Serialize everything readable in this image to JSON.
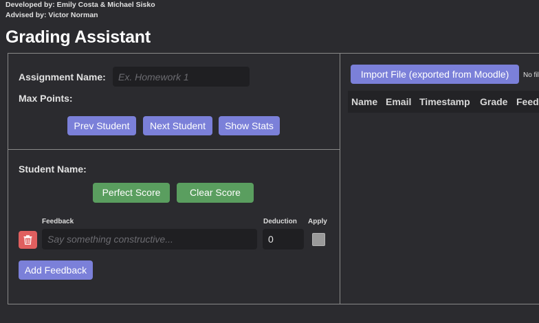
{
  "credits": {
    "developed_by": "Developed by: Emily Costa & Michael Sisko",
    "advised_by": "Advised by: Victor Norman"
  },
  "app": {
    "title": "Grading Assistant"
  },
  "assignment": {
    "name_label": "Assignment Name:",
    "name_value": "",
    "name_placeholder": "Ex. Homework 1",
    "max_points_label": "Max Points:",
    "prev_student_label": "Prev Student",
    "next_student_label": "Next Student",
    "show_stats_label": "Show Stats"
  },
  "student": {
    "name_label": "Student Name:",
    "perfect_score_label": "Perfect Score",
    "clear_score_label": "Clear Score",
    "feedback_header": "Feedback",
    "deduction_header": "Deduction",
    "apply_header": "Apply",
    "feedback_rows": [
      {
        "feedback_value": "",
        "feedback_placeholder": "Say something constructive...",
        "deduction": "0",
        "applied": false
      }
    ],
    "add_feedback_label": "Add Feedback"
  },
  "import": {
    "button_label": "Import File (exported from Moodle)",
    "file_status": "No fil"
  },
  "table": {
    "columns": [
      "Name",
      "Email",
      "Timestamp",
      "Grade",
      "Feed"
    ],
    "rows": []
  },
  "colors": {
    "background": "#2b2b2f",
    "primary_button": "#7b80d9",
    "success_button": "#5a9e5f",
    "danger_button": "#e05f5f"
  },
  "icons": {
    "delete_feedback": "trash-icon"
  }
}
